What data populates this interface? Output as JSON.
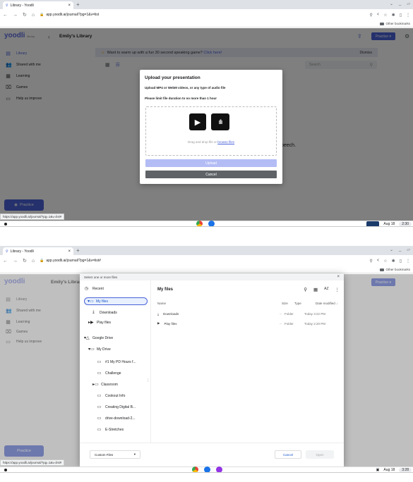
{
  "shot1": {
    "browser": {
      "tab_title": "Library - Yoodli",
      "url": "app.yoodli.ai/journal/?pg=1&v=list",
      "other_bookmarks": "Other bookmarks"
    },
    "app": {
      "logo": "yoodli",
      "logo_sub": "library",
      "back": "‹",
      "title": "Emily's Library",
      "practice_label": "Practice ▾",
      "banner_text": "Want to warm up with a fun 30 second speaking game?",
      "banner_link": "Click here!",
      "banner_dismiss": "Dismiss",
      "search_placeholder": "Search",
      "sidebar": [
        {
          "label": "Library",
          "icon": "book-icon"
        },
        {
          "label": "Shared with me",
          "icon": "people-icon"
        },
        {
          "label": "Learning",
          "icon": "grid-icon"
        },
        {
          "label": "Games",
          "icon": "gamepad-icon"
        },
        {
          "label": "Help us improve",
          "icon": "feedback-icon"
        }
      ],
      "practice_fab": "Practice",
      "bg_text": "peech.",
      "status_url": "https://app.yoodli.ai/journal/?pg=1&v=list#"
    },
    "dialog": {
      "title": "Upload your presentation",
      "line1": "Upload MP4 or WebM videos, or any type of audio file",
      "line2": "Please limit file duration to no more than 1 hour",
      "drag_text": "Drag and drop file or",
      "browse_link": "browse files",
      "upload_label": "Upload",
      "cancel_label": "Cancel"
    },
    "shelf": {
      "date": "Aug 18",
      "time": "2:30"
    }
  },
  "shot2": {
    "browser": {
      "tab_title": "Library - Yoodli",
      "url": "app.yoodli.ai/journal/?pg=1&v=list#",
      "other_bookmarks": "Other bookmarks"
    },
    "app": {
      "logo": "yoodli",
      "title": "Emily's Library",
      "practice_fab": "Practice",
      "sidebar": [
        "Library",
        "Shared with me",
        "Learning",
        "Games",
        "Help us improve"
      ],
      "status_url": "https://app.yoodli.ai/journal/?pg=1&v=list#"
    },
    "picker": {
      "header": "Select one or more files",
      "recent": "Recent",
      "my_files": "My files",
      "downloads": "Downloads",
      "play_files": "Play files",
      "google_drive": "Google Drive",
      "my_drive": "My Drive",
      "drive_folders": [
        "#1 My PD Hours f...",
        "Challenge",
        "Classroom",
        "Cookout Info",
        "Creating Digital B...",
        "drive-download-2...",
        "E-Stretches"
      ],
      "main_title": "My files",
      "columns": {
        "name": "Name",
        "size": "Size",
        "type": "Type",
        "date": "Date modified ↓"
      },
      "rows": [
        {
          "name": "Downloads",
          "size": "--",
          "type": "Folder",
          "date": "Today 3:22 PM"
        },
        {
          "name": "Play files",
          "size": "--",
          "type": "Folder",
          "date": "Today 2:20 PM"
        }
      ],
      "file_type": "Custom Files",
      "cancel": "Cancel",
      "open": "Open"
    },
    "shelf": {
      "date": "Aug 18",
      "time": "3:28"
    }
  },
  "colors": {
    "accent": "#4a62d8",
    "banner_bg": "#e8eaf6",
    "upload_disabled": "#b3bcf5",
    "cancel_bg": "#5f6368"
  }
}
